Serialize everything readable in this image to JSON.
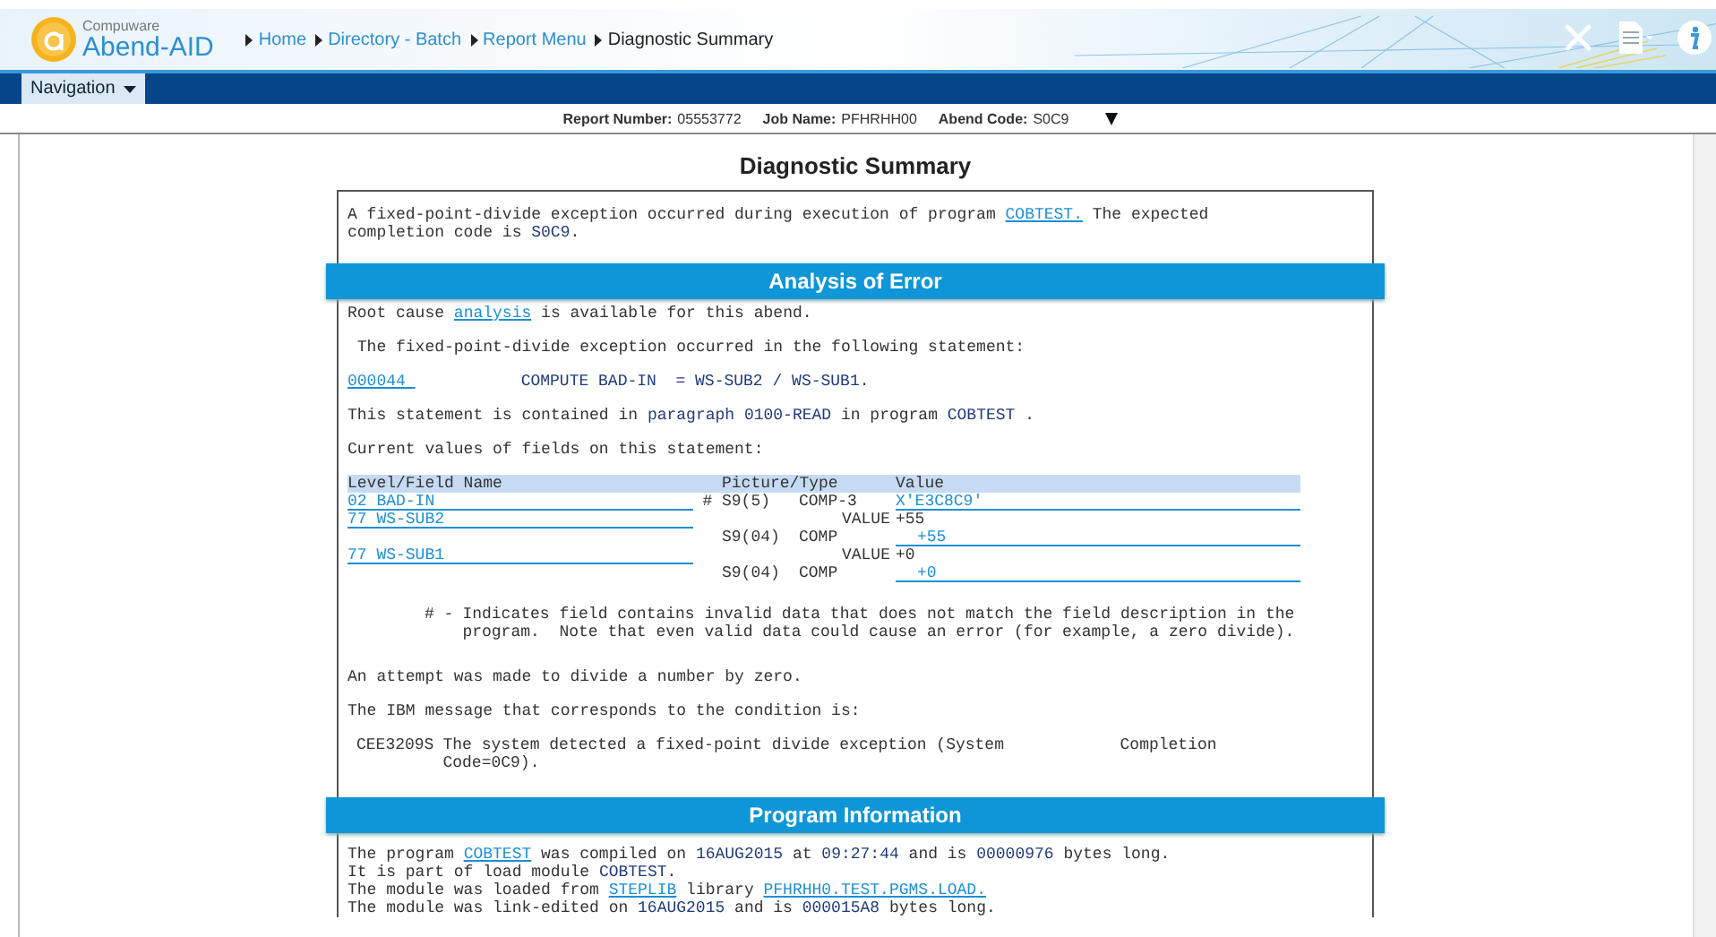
{
  "header": {
    "brand": "Compuware",
    "product": "Abend-AID",
    "breadcrumbs": [
      {
        "label": "Home",
        "link": true
      },
      {
        "label": "Directory - Batch",
        "link": true
      },
      {
        "label": "Report Menu",
        "link": true
      },
      {
        "label": "Diagnostic Summary",
        "link": false
      }
    ]
  },
  "nav": {
    "label": "Navigation"
  },
  "report_info": [
    {
      "label": "Report Number:",
      "value": "05553772"
    },
    {
      "label": "Job Name:",
      "value": "PFHRHH00"
    },
    {
      "label": "Abend Code:",
      "value": "S0C9"
    }
  ],
  "title": "Diagnostic Summary",
  "intro": [
    "A fixed-point-divide exception occurred during execution of program ",
    {
      "text": "COBTEST.",
      "kind": "link"
    },
    " The expected\ncompletion code is ",
    {
      "text": "S0C9",
      "kind": "value"
    },
    "."
  ],
  "analysis": {
    "title": "Analysis of Error",
    "paragraphs_before": [
      [
        "Root cause ",
        {
          "text": "analysis",
          "kind": "link"
        },
        " is available for this abend."
      ],
      [
        " The fixed-point-divide exception occurred in the following statement:"
      ],
      [
        {
          "text": "000044 ",
          "kind": "link"
        },
        {
          "text": "COMPUTE BAD-IN  = WS-SUB2 / WS-SUB1.",
          "kind": "code"
        }
      ],
      [
        "This statement is contained in ",
        {
          "text": "paragraph 0100-READ",
          "kind": "value"
        },
        " in program ",
        {
          "text": "COBTEST",
          "kind": "value"
        },
        " ."
      ],
      [
        "Current values of fields on this statement:"
      ]
    ],
    "table": {
      "columns": [
        "Level/Field Name",
        "Picture/Type",
        "Value"
      ],
      "fields": [
        {
          "name": "02 BAD-IN",
          "marker": "#",
          "picture": "S9(5)",
          "usage": "COMP-3",
          "value": "X'E3C8C9'"
        },
        {
          "name": "77 WS-SUB2",
          "initial": "VALUE",
          "initial_value": "+55",
          "picture": "S9(04)",
          "usage": "COMP",
          "value": "+55"
        },
        {
          "name": "77 WS-SUB1",
          "initial": "VALUE",
          "initial_value": "+0",
          "picture": "S9(04)",
          "usage": "COMP",
          "value": "+0"
        }
      ]
    },
    "note": {
      "marker": "# -",
      "lines": [
        "Indicates field contains invalid data that does not match the field description in the",
        "program.  Note that even valid data could cause an error (for example, a zero divide)."
      ]
    },
    "paragraphs_after": [
      [
        "An attempt was made to divide a number by zero."
      ],
      [
        "The IBM message that corresponds to the condition is:"
      ]
    ],
    "ibm_message": {
      "code": "CEE3209S",
      "lines": [
        "The system detected a fixed-point divide exception (System            Completion",
        "Code=0C9)."
      ]
    }
  },
  "program_info": {
    "title": "Program Information",
    "lines": [
      [
        "The program ",
        {
          "text": "COBTEST",
          "kind": "link"
        },
        " was compiled on ",
        {
          "text": "16AUG2015",
          "kind": "value"
        },
        " at ",
        {
          "text": "09:27:44",
          "kind": "value"
        },
        " and is ",
        {
          "text": "00000976",
          "kind": "value"
        },
        " bytes long."
      ],
      [
        "It is part of load module ",
        {
          "text": "COBTEST",
          "kind": "value"
        },
        "."
      ],
      [
        "The module was loaded from ",
        {
          "text": "STEPLIB",
          "kind": "link"
        },
        " library ",
        {
          "text": "PFHRHH0.TEST.PGMS.LOAD.",
          "kind": "link"
        }
      ],
      [
        "The module was link-edited on ",
        {
          "text": "16AUG2015",
          "kind": "value"
        },
        " and is ",
        {
          "text": "000015A8",
          "kind": "value"
        },
        " bytes long."
      ]
    ]
  }
}
